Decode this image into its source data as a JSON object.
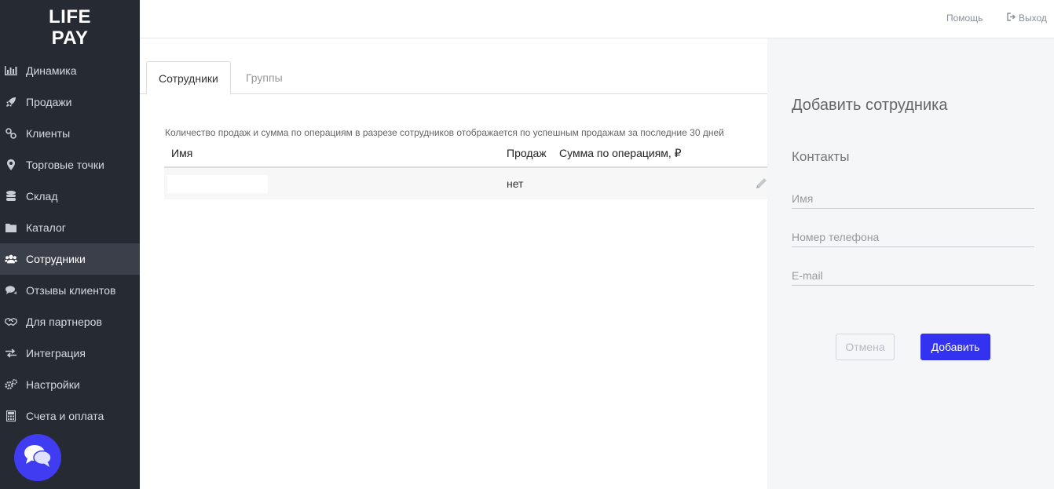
{
  "brand": {
    "logo_line1": "LIFE",
    "logo_line2": "PAY",
    "accent": "#3232f0",
    "sidebar_bg": "#262a33"
  },
  "sidebar": {
    "items": [
      {
        "label": "Динамика",
        "icon": "bar-chart-icon"
      },
      {
        "label": "Продажи",
        "icon": "rocket-icon"
      },
      {
        "label": "Клиенты",
        "icon": "link-icon"
      },
      {
        "label": "Торговые точки",
        "icon": "map-marker-icon"
      },
      {
        "label": "Склад",
        "icon": "database-icon"
      },
      {
        "label": "Каталог",
        "icon": "folder-icon"
      },
      {
        "label": "Сотрудники",
        "icon": "users-icon",
        "active": true
      },
      {
        "label": "Отзывы клиентов",
        "icon": "comments-icon"
      },
      {
        "label": "Для партнеров",
        "icon": "handshake-icon"
      },
      {
        "label": "Интеграция",
        "icon": "exchange-icon"
      },
      {
        "label": "Настройки",
        "icon": "cogs-icon"
      },
      {
        "label": "Счета и оплата",
        "icon": "calculator-icon"
      }
    ]
  },
  "topbar": {
    "help": "Помощь",
    "exit": "Выход"
  },
  "tabs": [
    {
      "label": "Сотрудники",
      "active": true
    },
    {
      "label": "Группы",
      "active": false
    }
  ],
  "main": {
    "note": "Количество продаж и сумма по операциям в разрезе сотрудников отображается по успешным продажам за последние 30 дней",
    "columns": {
      "name": "Имя",
      "sales": "Продаж",
      "sum": "Сумма по операциям, ₽"
    },
    "rows": [
      {
        "name": "",
        "sales": "нет",
        "sum": ""
      }
    ]
  },
  "panel": {
    "title": "Добавить сотрудника",
    "section": "Контакты",
    "name_placeholder": "Имя",
    "phone_placeholder": "Номер телефона",
    "email_placeholder": "E-mail",
    "cancel_label": "Отмена",
    "add_label": "Добавить"
  }
}
